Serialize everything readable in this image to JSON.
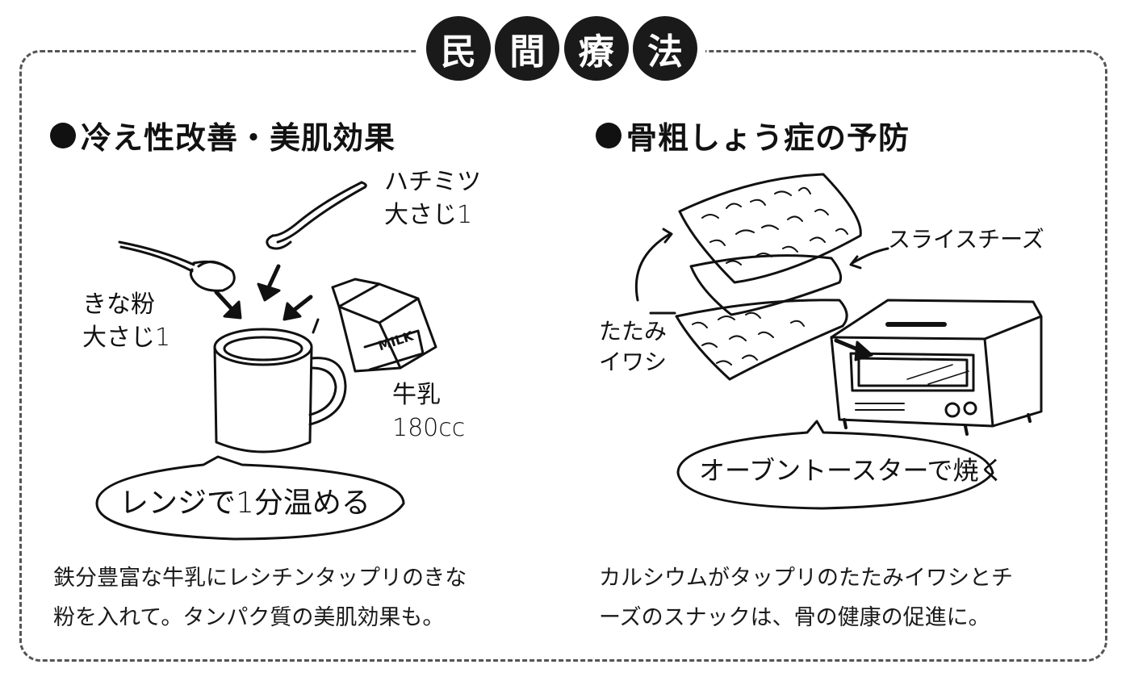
{
  "title_chars": [
    "民",
    "間",
    "療",
    "法"
  ],
  "left": {
    "heading": "冷え性改善・美肌効果",
    "labels": {
      "honey": "ハチミツ\n大さじ1",
      "kinako": "きな粉\n大さじ1",
      "milk": "牛乳\n180cc",
      "carton": "MILK"
    },
    "bubble": "レンジで1分温める",
    "body": [
      "鉄分豊富な牛乳にレシチンタップリのきな",
      "粉を入れて。タンパク質の美肌効果も。"
    ]
  },
  "right": {
    "heading": "骨粗しょう症の予防",
    "labels": {
      "cheese": "スライスチーズ",
      "iwashi": "たたみ\nイワシ"
    },
    "bubble": "オーブントースターで焼く",
    "body": [
      "カルシウムがタップリのたたみイワシとチ",
      "ーズのスナックは、骨の健康の促進に。"
    ]
  },
  "colors": {
    "ink": "#111111",
    "frame": "#555555",
    "badge": "#1a1a1a"
  }
}
